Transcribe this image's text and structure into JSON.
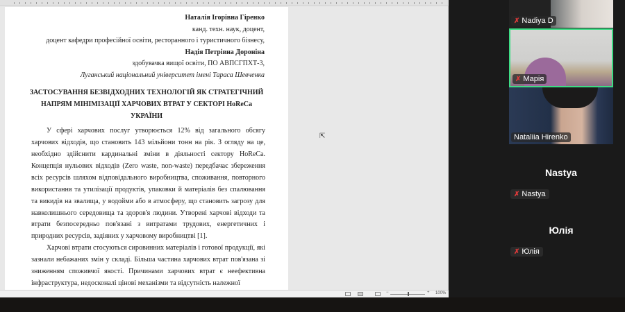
{
  "document": {
    "author1_name": "Наталія Ігорівна Гіренко",
    "author1_degree": "канд. техн. наук, доцент,",
    "author1_position": "доцент кафедри професійної освіти, ресторанного і туристичного бізнесу,",
    "author2_name": "Надія Петрівна Дороніна",
    "author2_position": "здобувачка вищої освіти, ПО АВПСГПХТ-3,",
    "university": "Луганський національний університет імені Тараса Шевченка",
    "title_lines": [
      "ЗАСТОСУВАННЯ БЕЗВІДХОДНИХ ТЕХНОЛОГІЙ ЯК СТРАТЕГІЧНИЙ",
      "НАПРЯМ МІНІМІЗАЦІЇ ХАРЧОВИХ ВТРАТ У СЕКТОРІ HoReCa",
      "УКРАЇНИ"
    ],
    "paragraph1": "У сфері харчових послуг утворюється 12% від загального обсягу харчових відходів, що становить 143 мільйони тонн на рік. З огляду на це, необхідно здійснити кардинальні зміни в діяльності сектору HoReCa. Концепція нульових відходів (Zero waste, non-waste) передбачає збереження всіх ресурсів шляхом відповідального виробництва, споживання, повторного використання та утилізації продуктів, упаковки й матеріалів без спалювання та викидів на звалища, у водойми або в атмосферу, що становить загрозу для навколишнього середовища та здоров'я людини. Утворені харчові відходи та втрати безпосередньо пов'язані з витратами трудових, енергетичних і природних ресурсів, задіяних у харчовому виробництві [1].",
    "paragraph2": "Харчові втрати стосуються сировинних матеріалів і готової продукції, які зазнали небажаних змін у складі. Більша частина харчових втрат пов'язана зі зниженням споживчої якості. Причинами харчових втрат є неефективна інфраструктура, недосконалі цінові механізми та відсутність належної"
  },
  "statusbar": {
    "zoom": "100%"
  },
  "participants": [
    {
      "name": "Nadiya D",
      "muted": true
    },
    {
      "name": "Марія",
      "muted": true,
      "active_speaker": true
    },
    {
      "name": "Nataliia Hirenko",
      "muted": false
    },
    {
      "name": "Nastya",
      "muted": true,
      "video": false
    },
    {
      "name": "Юлія",
      "muted": true,
      "video": false
    }
  ],
  "colors": {
    "active_border": "#3ddc84",
    "muted_icon": "#e03a3a"
  }
}
